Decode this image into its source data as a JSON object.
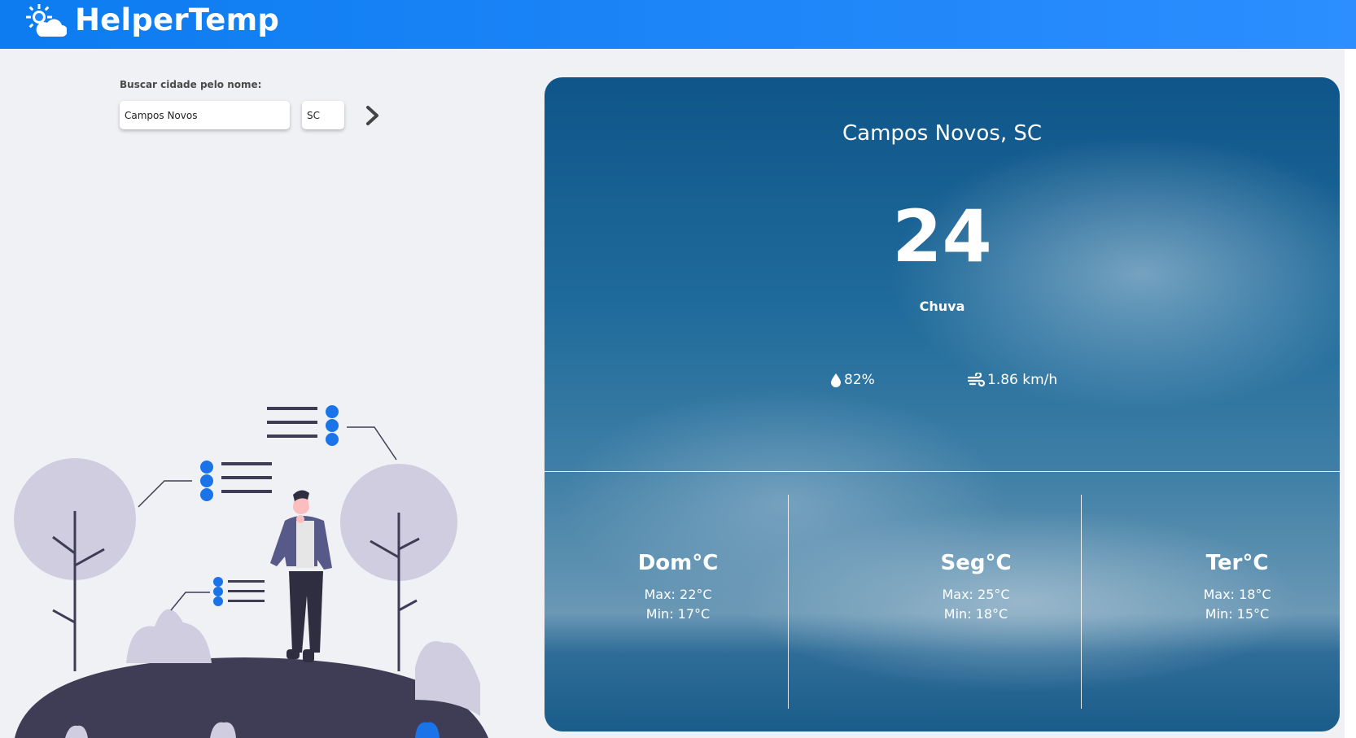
{
  "app": {
    "title": "HelperTemp",
    "logo_icon": "sun-cloud-icon"
  },
  "search": {
    "label": "Buscar cidade pelo nome:",
    "city_value": "Campos Novos",
    "state_value": "SC",
    "go_icon": "chevron-right-icon"
  },
  "weather": {
    "location": "Campos Novos, SC",
    "temperature": "24",
    "condition": "Chuva",
    "humidity": "82%",
    "humidity_icon": "droplet-icon",
    "wind": "1.86 km/h",
    "wind_icon": "wind-icon"
  },
  "forecast": [
    {
      "day": "Dom°C",
      "max": "Max: 22°C",
      "min": "Min: 17°C"
    },
    {
      "day": "Seg°C",
      "max": "Max: 25°C",
      "min": "Min: 18°C"
    },
    {
      "day": "Ter°C",
      "max": "Max: 18°C",
      "min": "Min: 15°C"
    }
  ],
  "colors": {
    "header": "#1e88ff",
    "background": "#f0f1f5",
    "accent_dots": "#1a73e8",
    "illustration_dark": "#3f3d56",
    "tree_light": "#d0cde1"
  }
}
